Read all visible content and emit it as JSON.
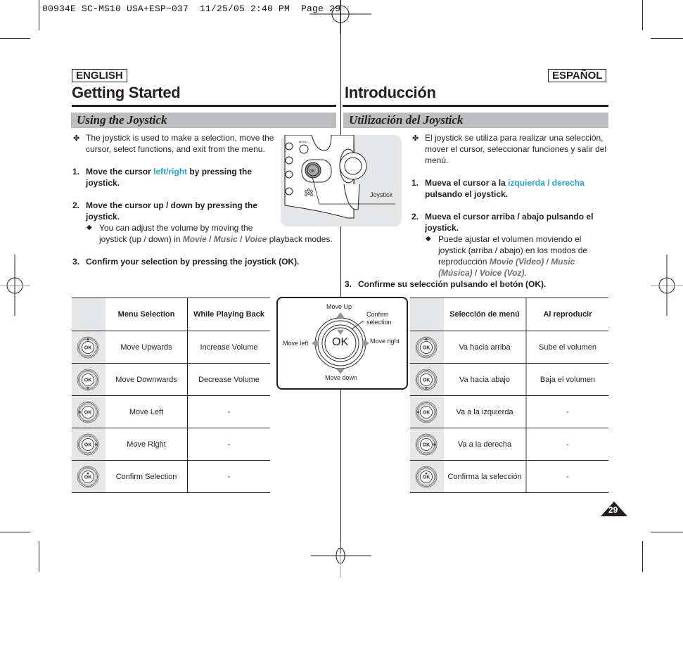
{
  "slug": "00934E SC-MS10 USA+ESP~037  11/25/05 2:40 PM  Page 29",
  "page_number": "29",
  "colors": {
    "accent_blue": "#1fa6dd",
    "subheading_bar": "#bcbdbf",
    "emphasis_gray": "#6d6e71",
    "table_icon_col": "#e6e7e8"
  },
  "english": {
    "lang_badge": "ENGLISH",
    "title": "Getting Started",
    "subtitle": "Using the Joystick",
    "intro": "The joystick is used to make a selection, move the cursor, select functions, and exit from the menu.",
    "intro_line1": "The joystick is used to make a selection, move the",
    "intro_line2": "cursor, select functions, and exit from the menu.",
    "step1_num": "1.",
    "step1_pre": "Move the cursor ",
    "step1_highlight": "left/right",
    "step1_post": " by pressing the",
    "step1_line2": "joystick.",
    "step2_num": "2.",
    "step2_line1": "Move the cursor up / down by pressing the",
    "step2_line2": "joystick.",
    "note_line1": "You can adjust the volume by moving the",
    "note_line2_pre": "joystick (up / down) in ",
    "note_movie": "Movie",
    "note_sep": " / ",
    "note_music": "Music",
    "note_voice": "Voice",
    "note_post": " playback modes.",
    "step3_num": "3.",
    "step3_text": "Confirm your selection by pressing the joystick (OK).",
    "table": {
      "headers": [
        "",
        "Menu Selection",
        "While Playing Back"
      ],
      "rows": [
        {
          "icon": "joystick-up-icon",
          "menu": "Move Upwards",
          "playback": "Increase Volume"
        },
        {
          "icon": "joystick-down-icon",
          "menu": "Move Downwards",
          "playback": "Decrease Volume"
        },
        {
          "icon": "joystick-left-icon",
          "menu": "Move Left",
          "playback": "-"
        },
        {
          "icon": "joystick-right-icon",
          "menu": "Move Right",
          "playback": "-"
        },
        {
          "icon": "joystick-press-icon",
          "menu": "Confirm Selection",
          "playback": "-"
        }
      ]
    }
  },
  "spanish": {
    "lang_badge": "ESPAÑOL",
    "title": "Introducción",
    "subtitle": "Utilización del Joystick",
    "intro_line1": "El joystick se utiliza para realizar una selección,",
    "intro_line2": "mover el cursor, seleccionar funciones y salir del",
    "intro_line3": "menú.",
    "step1_num": "1.",
    "step1_pre": "Mueva el cursor a la ",
    "step1_highlight": "izquierda / derecha",
    "step1_line2": "pulsando el joystick.",
    "step2_num": "2.",
    "step2_line1": "Mueva el cursor arriba / abajo pulsando el",
    "step2_line2": "joystick.",
    "note_line1": "Puede ajustar el volumen moviendo el",
    "note_line2": "joystick (arriba / abajo) en los modos de",
    "note_line3_pre": "reproducción ",
    "note_movie": "Movie (Video)",
    "note_sep": " / ",
    "note_music": "Music",
    "note_musica": "(Música)",
    "note_voice": "Voice (Voz).",
    "step3_num": "3.",
    "step3_text": "Confirme su selección pulsando el botón (OK).",
    "table": {
      "headers": [
        "",
        "Selección de menú",
        "Al reproducir"
      ],
      "rows": [
        {
          "icon": "joystick-up-icon",
          "menu": "Va hacia arriba",
          "playback": "Sube el volumen"
        },
        {
          "icon": "joystick-down-icon",
          "menu": "Va hacia abajo",
          "playback": "Baja el volumen"
        },
        {
          "icon": "joystick-left-icon",
          "menu": "Va a la izquierda",
          "playback": "-"
        },
        {
          "icon": "joystick-right-icon",
          "menu": "Va a la derecha",
          "playback": "-"
        },
        {
          "icon": "joystick-press-icon",
          "menu": "Confirma la selección",
          "playback": "-"
        }
      ]
    }
  },
  "camera_figure": {
    "callout": "Joystick",
    "button_label": "OK",
    "menu_label": "MENU"
  },
  "joystick_diagram": {
    "ok_label": "OK",
    "up": "Move Up",
    "down": "Move down",
    "left": "Move left",
    "right": "Move right",
    "confirm_line1": "Confirm",
    "confirm_line2": "selection"
  }
}
